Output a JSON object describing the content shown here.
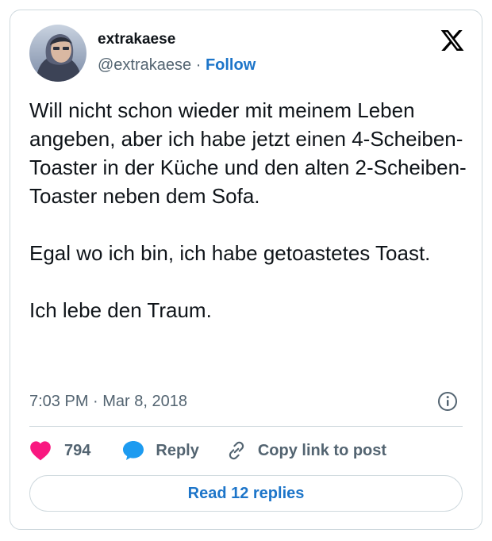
{
  "author": {
    "display_name": "extrakaese",
    "handle": "@extrakaese",
    "separator": "·",
    "follow_label": "Follow"
  },
  "brand": {
    "logo_icon": "x-logo-icon",
    "logo_color": "#000000"
  },
  "tweet": {
    "paragraphs": [
      "Will nicht schon wieder mit meinem Leben angeben, aber ich habe jetzt einen 4-Scheiben-Toaster in der Küche und den alten 2-Scheiben-Toaster neben dem Sofa.",
      "Egal wo ich bin, ich habe getoastetes Toast.",
      "Ich lebe den Traum."
    ],
    "timestamp": "7:03 PM · Mar 8, 2018"
  },
  "actions": {
    "like_count": "794",
    "reply_label": "Reply",
    "copy_link_label": "Copy link to post",
    "read_replies_label": "Read 12 replies"
  },
  "colors": {
    "like": "#f91880",
    "reply": "#1d9bf0",
    "link": "#1d75c9",
    "muted": "#536471",
    "border": "#cfd9de"
  }
}
